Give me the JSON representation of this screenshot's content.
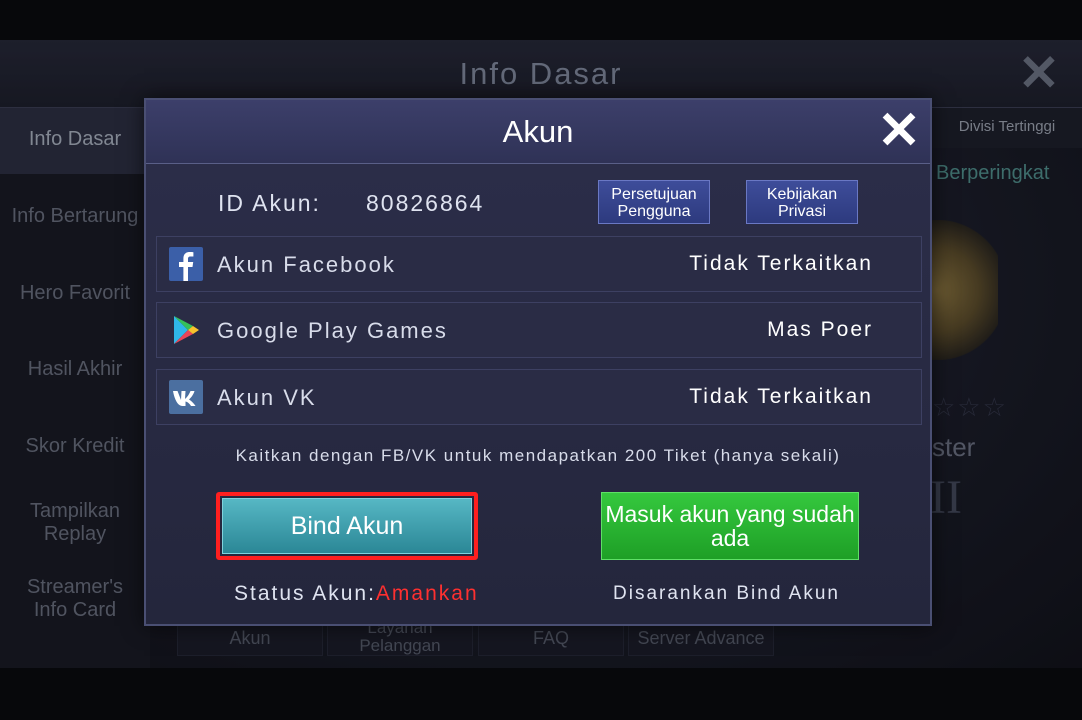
{
  "background": {
    "title": "Info Dasar",
    "sidebar": [
      {
        "label": "Info Dasar"
      },
      {
        "label": "Info Bertarung"
      },
      {
        "label": "Hero Favorit"
      },
      {
        "label": "Hasil Akhir"
      },
      {
        "label": "Skor Kredit"
      },
      {
        "label": "Tampilkan Replay"
      },
      {
        "label": "Streamer's Info Card"
      }
    ],
    "right_tab": "Divisi Tertinggi",
    "right_text": "Berperingkat",
    "rank_partial": "ster",
    "bottom_tabs": [
      {
        "label": "Akun"
      },
      {
        "label": "Layanan Pelanggan"
      },
      {
        "label": "FAQ"
      },
      {
        "label": "Server Advance"
      }
    ]
  },
  "dialog": {
    "title": "Akun",
    "id_label": "ID Akun:",
    "id_value": "80826864",
    "agreement_button": "Persetujuan Pengguna",
    "privacy_button": "Kebijakan Privasi",
    "accounts": [
      {
        "name": "Akun Facebook",
        "status": "Tidak Terkaitkan",
        "icon": "facebook-icon"
      },
      {
        "name": "Google Play Games",
        "status": "Mas Poer",
        "icon": "google-play-icon"
      },
      {
        "name": "Akun VK",
        "status": "Tidak Terkaitkan",
        "icon": "vk-icon"
      }
    ],
    "promo_text": "Kaitkan dengan FB/VK untuk mendapatkan 200 Tiket (hanya sekali)",
    "bind_button": "Bind Akun",
    "login_button": "Masuk akun yang sudah ada",
    "status_label": "Status Akun:",
    "status_value": "Amankan",
    "recommendation": "Disarankan Bind Akun"
  },
  "colors": {
    "highlight_outline": "#ff1f1f",
    "bind_button": "#3fa3b1",
    "login_button": "#28b530",
    "status_value": "#ff3030"
  }
}
